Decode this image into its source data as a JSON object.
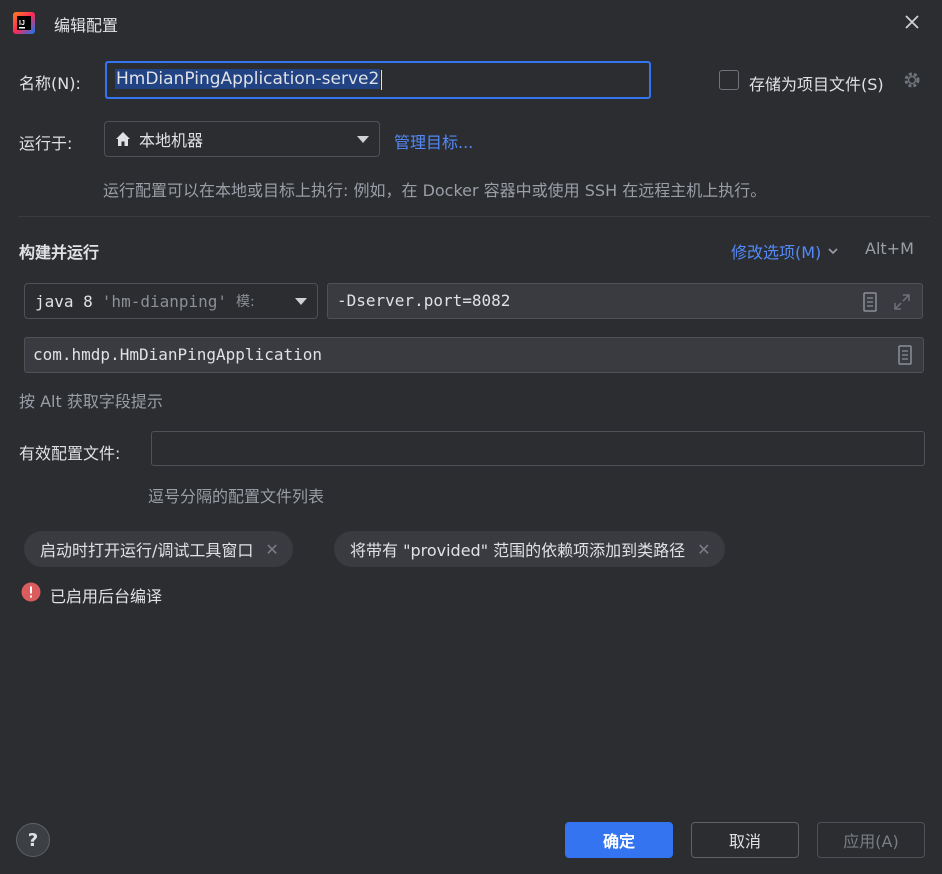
{
  "window": {
    "title": "编辑配置",
    "accent": "#3574f0"
  },
  "name_row": {
    "label": "名称(N):",
    "value": "HmDianPingApplication-serve2",
    "store_as_file_label": "存储为项目文件(S)",
    "store_as_file_checked": false
  },
  "run_on": {
    "label": "运行于:",
    "selected": "本地机器",
    "manage_targets": "管理目标...",
    "hint": "运行配置可以在本地或目标上执行: 例如，在 Docker 容器中或使用 SSH 在远程主机上执行。"
  },
  "build_run": {
    "section_title": "构建并运行",
    "modify_options": "修改选项(M)",
    "shortcut": "Alt+M",
    "jdk_prefix": "java 8",
    "jdk_module": "'hm-dianping'",
    "jdk_suffix": "模:",
    "vm_options": "-Dserver.port=8082",
    "main_class": "com.hmdp.HmDianPingApplication",
    "alt_hint": "按 Alt 获取字段提示"
  },
  "profiles": {
    "label": "有效配置文件:",
    "value": "",
    "hint": "逗号分隔的配置文件列表"
  },
  "chips": [
    {
      "label": "启动时打开运行/调试工具窗口"
    },
    {
      "label": "将带有 \"provided\" 范围的依赖项添加到类路径"
    }
  ],
  "status": {
    "text": "已启用后台编译",
    "color": "#db5c5c"
  },
  "footer": {
    "help": "?",
    "ok": "确定",
    "cancel": "取消",
    "apply": "应用(A)"
  }
}
